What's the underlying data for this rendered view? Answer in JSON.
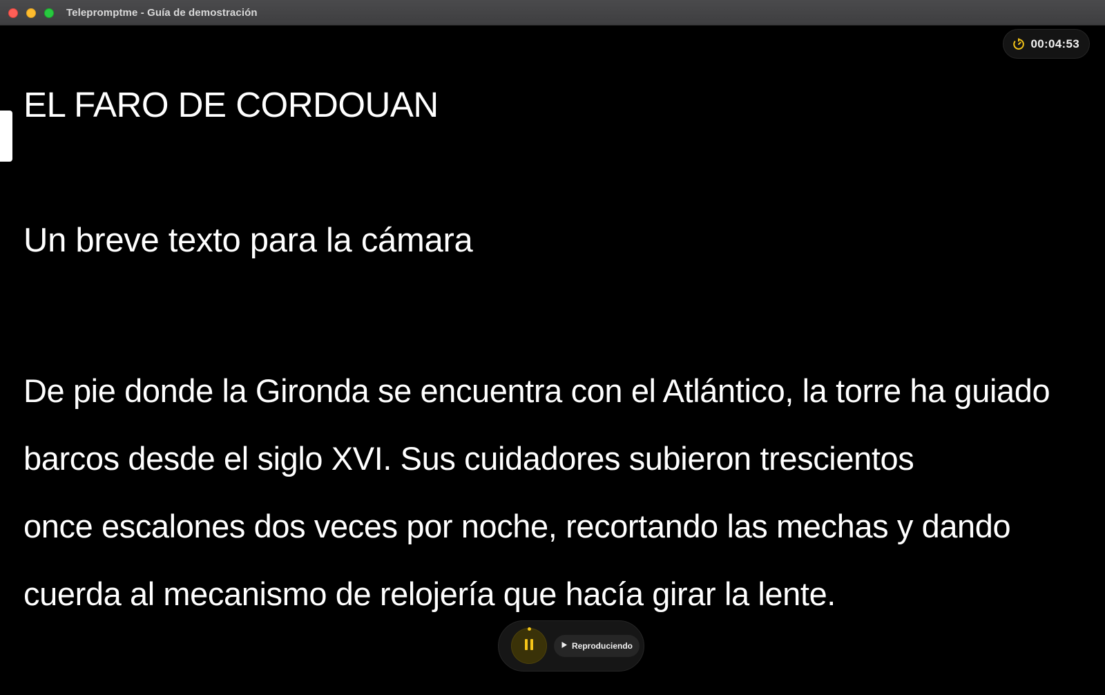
{
  "window": {
    "title": "Telepromptme - Guía de demostración"
  },
  "timer": {
    "icon": "timer-icon",
    "value": "00:04:53",
    "icon_color": "#f5c518"
  },
  "script": {
    "title": "EL FARO DE CORDOUAN",
    "subtitle": "Un breve texto para la cámara",
    "lines": [
      "De pie donde la Gironda se encuentra con el Atlántico, la torre ha guiado",
      "barcos desde el siglo XVI. Sus cuidadores subieron trescientos",
      "once escalones dos veces por noche, recortando las mechas y dando",
      "cuerda al mecanismo de relojería que hacía girar la lente."
    ]
  },
  "controls": {
    "pause_icon": "pause-icon",
    "status_icon": "play-icon",
    "status_label": "Reproduciendo",
    "accent_color": "#f5c518"
  }
}
